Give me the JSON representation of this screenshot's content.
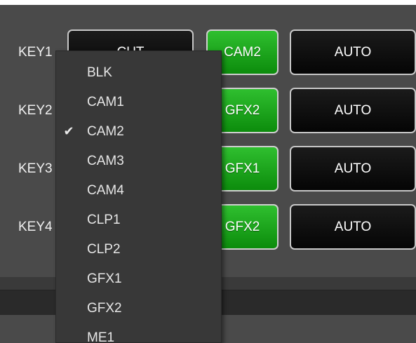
{
  "colors": {
    "panel": "#4a4a4a",
    "green_button": "#1aa51a",
    "dark_button": "#0d0d0d",
    "menu_bg": "#383838"
  },
  "rows": [
    {
      "key_label": "KEY1",
      "transition_label": "CUT",
      "source_label": "CAM2",
      "mode_label": "AUTO"
    },
    {
      "key_label": "KEY2",
      "transition_label": "",
      "source_label": "GFX2",
      "mode_label": "AUTO"
    },
    {
      "key_label": "KEY3",
      "transition_label": "",
      "source_label": "GFX1",
      "mode_label": "AUTO"
    },
    {
      "key_label": "KEY4",
      "transition_label": "",
      "source_label": "GFX2",
      "mode_label": "AUTO"
    }
  ],
  "dropdown": {
    "check_icon": "checkmark-icon",
    "check_glyph": "✔",
    "items": [
      {
        "label": "BLK",
        "checked": false
      },
      {
        "label": "CAM1",
        "checked": false
      },
      {
        "label": "CAM2",
        "checked": true
      },
      {
        "label": "CAM3",
        "checked": false
      },
      {
        "label": "CAM4",
        "checked": false
      },
      {
        "label": "CLP1",
        "checked": false
      },
      {
        "label": "CLP2",
        "checked": false
      },
      {
        "label": "GFX1",
        "checked": false
      },
      {
        "label": "GFX2",
        "checked": false
      },
      {
        "label": "ME1",
        "checked": false
      }
    ]
  }
}
